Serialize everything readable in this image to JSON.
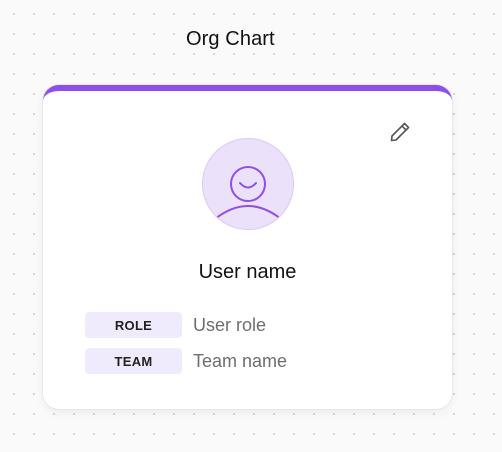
{
  "canvas": {
    "title": "Org Chart"
  },
  "card": {
    "accent_color": "#8e4ee8",
    "edit_icon": "pencil-icon",
    "avatar_icon": "user-avatar-icon",
    "user_name": "User name",
    "fields": [
      {
        "badge": "ROLE",
        "value": "User role"
      },
      {
        "badge": "TEAM",
        "value": "Team name"
      }
    ]
  }
}
